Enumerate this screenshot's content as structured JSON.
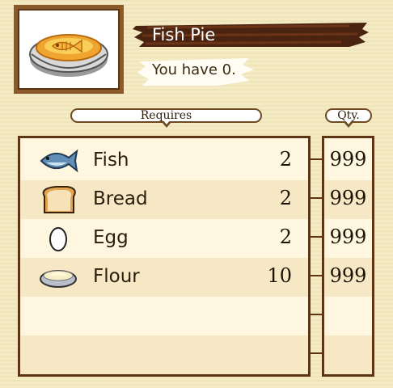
{
  "item": {
    "name": "Fish Pie",
    "have_text": "You have 0.",
    "icon": "fish-pie-icon"
  },
  "headers": {
    "requires": "Requires",
    "qty": "Qty."
  },
  "ingredients": [
    {
      "name": "Fish",
      "icon": "fish-icon",
      "required": "2",
      "qty": "999"
    },
    {
      "name": "Bread",
      "icon": "bread-icon",
      "required": "2",
      "qty": "999"
    },
    {
      "name": "Egg",
      "icon": "egg-icon",
      "required": "2",
      "qty": "999"
    },
    {
      "name": "Flour",
      "icon": "flour-icon",
      "required": "10",
      "qty": "999"
    }
  ],
  "colors": {
    "background": "#f4ebc4",
    "border": "#5e3514",
    "frame": "#8b5a2b",
    "row_alt": "#f6e8c4",
    "title_scribble": "#4a2410"
  }
}
